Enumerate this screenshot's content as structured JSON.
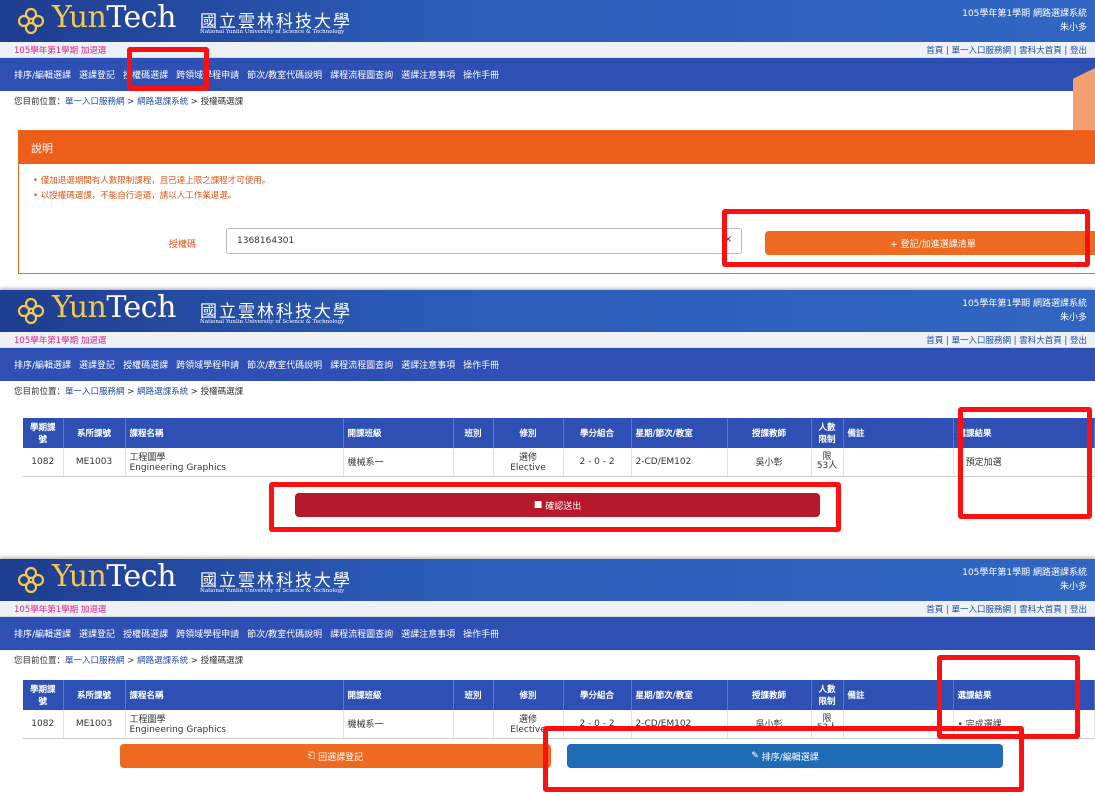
{
  "header": {
    "logo_yun": "Yun",
    "logo_tech": "Tech",
    "university_cn": "國立雲林科技大學",
    "university_en": "National Yunlin University of Science & Technology",
    "system_title": "105學年第1學期  網路選課系統",
    "user_name": "朱小多"
  },
  "semester_bar": {
    "label": "105學年第1學期 加退選",
    "links": "首頁 | 單一入口服務網 | 雲科大首頁 | 登出"
  },
  "nav": {
    "items": [
      "排序/編輯選課",
      "選課登記",
      "授權碼選課",
      "跨領域學程申請",
      "節次/教室代碼說明",
      "課程流程圖查詢",
      "選課注意事項",
      "操作手冊"
    ]
  },
  "breadcrumb": {
    "prefix": "您目前位置：",
    "item1": "單一入口服務網",
    "item2": "網路選課系統",
    "item3": "授權碼選課",
    "sep": " > "
  },
  "description": {
    "title": "說明",
    "line1": "• 僅加退選期間有人數限制課程，且已達上限之課程才可使用。",
    "line2": "• 以授權碼選課，不能自行退選，請以人工作業退選。"
  },
  "auth_code": {
    "label": "授權碼",
    "value": "1368164301",
    "clear_icon": "×",
    "add_button": "+ 登記/加進選課清單"
  },
  "table": {
    "headers": [
      "學期課號",
      "系所課號",
      "課程名稱",
      "開課班級",
      "班別",
      "修別",
      "學分組合",
      "星期/節次/教室",
      "授課教師",
      "人數限制",
      "備註",
      "選課結果"
    ],
    "row": {
      "term_no": "1082",
      "dept_no": "ME1003",
      "name_cn": "工程圖學",
      "name_en": "Engineering Graphics",
      "class": "機械系一",
      "section": "",
      "type_cn": "選修",
      "type_en": "Elective",
      "credits": "2 - 0 - 2",
      "schedule": "2-CD/EM102",
      "teacher": "吳小彰",
      "limit_a": "限",
      "limit_b": "53人",
      "note": ""
    },
    "result_pending": "• 預定加選",
    "result_done": "• 完成選課"
  },
  "buttons": {
    "confirm": "確認送出",
    "back": "回選課登記",
    "edit": "排序/編輯選課"
  },
  "colors": {
    "nav_blue": "#2e4fb3",
    "orange": "#ef6a21",
    "confirm_red": "#b5192b",
    "edit_blue": "#1f6bb5",
    "highlight_red": "#ff1010"
  }
}
